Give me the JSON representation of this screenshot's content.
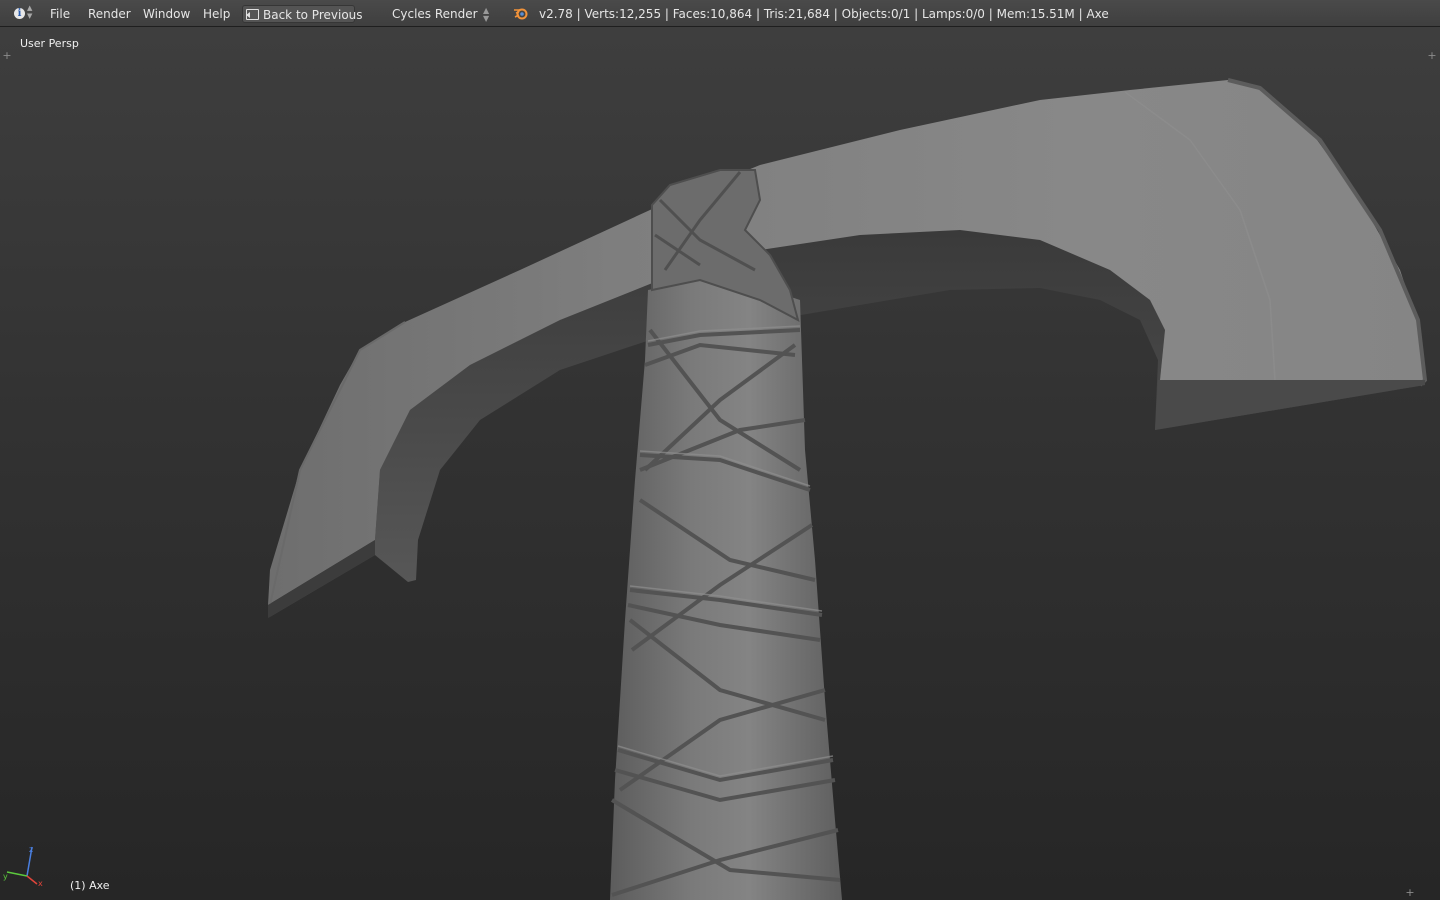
{
  "header": {
    "editor_type_icon": "info-icon",
    "menus": [
      "File",
      "Render",
      "Window",
      "Help"
    ],
    "back_button": {
      "label": "Back to Previous",
      "icon": "back-icon"
    },
    "render_engine": "Cycles Render",
    "logo_icon": "blender-logo-icon",
    "stats": "v2.78 | Verts:12,255 | Faces:10,864 | Tris:21,684 | Objects:0/1 | Lamps:0/0 | Mem:15.51M | Axe"
  },
  "viewport": {
    "view_name": "User Persp",
    "active_object": "(1) Axe",
    "axis_labels": {
      "x": "x",
      "y": "y",
      "z": "z"
    },
    "colors": {
      "x": "#e0443a",
      "y": "#5cc93d",
      "z": "#4a7fe0"
    }
  }
}
